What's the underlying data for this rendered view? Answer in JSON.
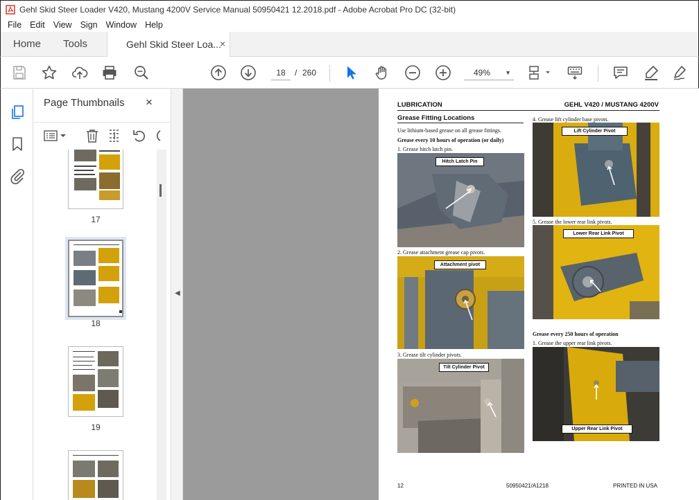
{
  "window": {
    "title": "Gehl Skid Steer Loader V420, Mustang 4200V Service Manual 50950421 12.2018.pdf - Adobe Acrobat Pro DC (32-bit)"
  },
  "menu": [
    "File",
    "Edit",
    "View",
    "Sign",
    "Window",
    "Help"
  ],
  "tabs": {
    "home": "Home",
    "tools": "Tools",
    "document": "Gehl Skid Steer Loa...",
    "close": "×"
  },
  "toolbar": {
    "current_page": "18",
    "page_separator": "/",
    "total_pages": "260",
    "zoom": "49%"
  },
  "thumbnails_panel": {
    "title": "Page Thumbnails",
    "close": "×",
    "pages": [
      "17",
      "18",
      "19"
    ]
  },
  "page": {
    "header_left": "LUBRICATION",
    "header_right": "GEHL V420 / MUSTANG 4200V",
    "section_title": "Grease Fitting Locations",
    "intro": "Use lithium-based grease on all grease fittings.",
    "interval_1": "Grease every 10 hours of operation (or daily)",
    "step_1": "1.    Grease hitch latch pin.",
    "photo_1_label": "Hitch Latch Pin",
    "step_2": "2.    Grease attachment grease cap pivots.",
    "photo_2_label": "Attachment pivot",
    "step_3": "3.    Grease tilt cylinder pivots.",
    "photo_3_label": "Tilt Cylinder Pivot",
    "step_4": "4.    Grease lift cylinder base pivots.",
    "photo_4_label": "Lift Cylinder Pivot",
    "step_5": "5.    Grease the lower rear link pivots.",
    "photo_5_label": "Lower Rear Link Pivot",
    "interval_2": "Grease every 250 hours of operation",
    "step_6": "1.    Grease the upper rear link pivots.",
    "photo_6_label": "Upper Rear Link Pivot",
    "footer_left": "12",
    "footer_center": "50950421/A1218",
    "footer_right": "PRINTED IN USA"
  },
  "colors": {
    "acrobat_red": "#d7281f",
    "select_blue": "#1473e6",
    "machine_yellow": "#e3b40c",
    "machine_gray": "#5d6b78"
  }
}
